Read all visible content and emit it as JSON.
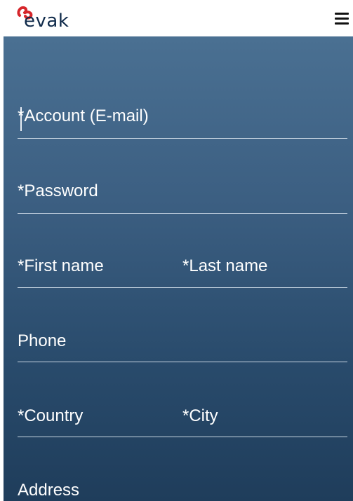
{
  "header": {
    "logo_text": "evak",
    "menu_icon": "hamburger-menu-icon"
  },
  "form": {
    "account": "*Account (E-mail)",
    "password": "*Password",
    "first_name": "*First name",
    "last_name": "*Last name",
    "phone": "Phone",
    "country": "*Country",
    "city": "*City",
    "address": "Address"
  },
  "colors": {
    "brand_red": "#d6262b",
    "brand_navy": "#0f2a4a",
    "panel_top": "#4a7092",
    "panel_bottom": "#1f3d5b"
  }
}
